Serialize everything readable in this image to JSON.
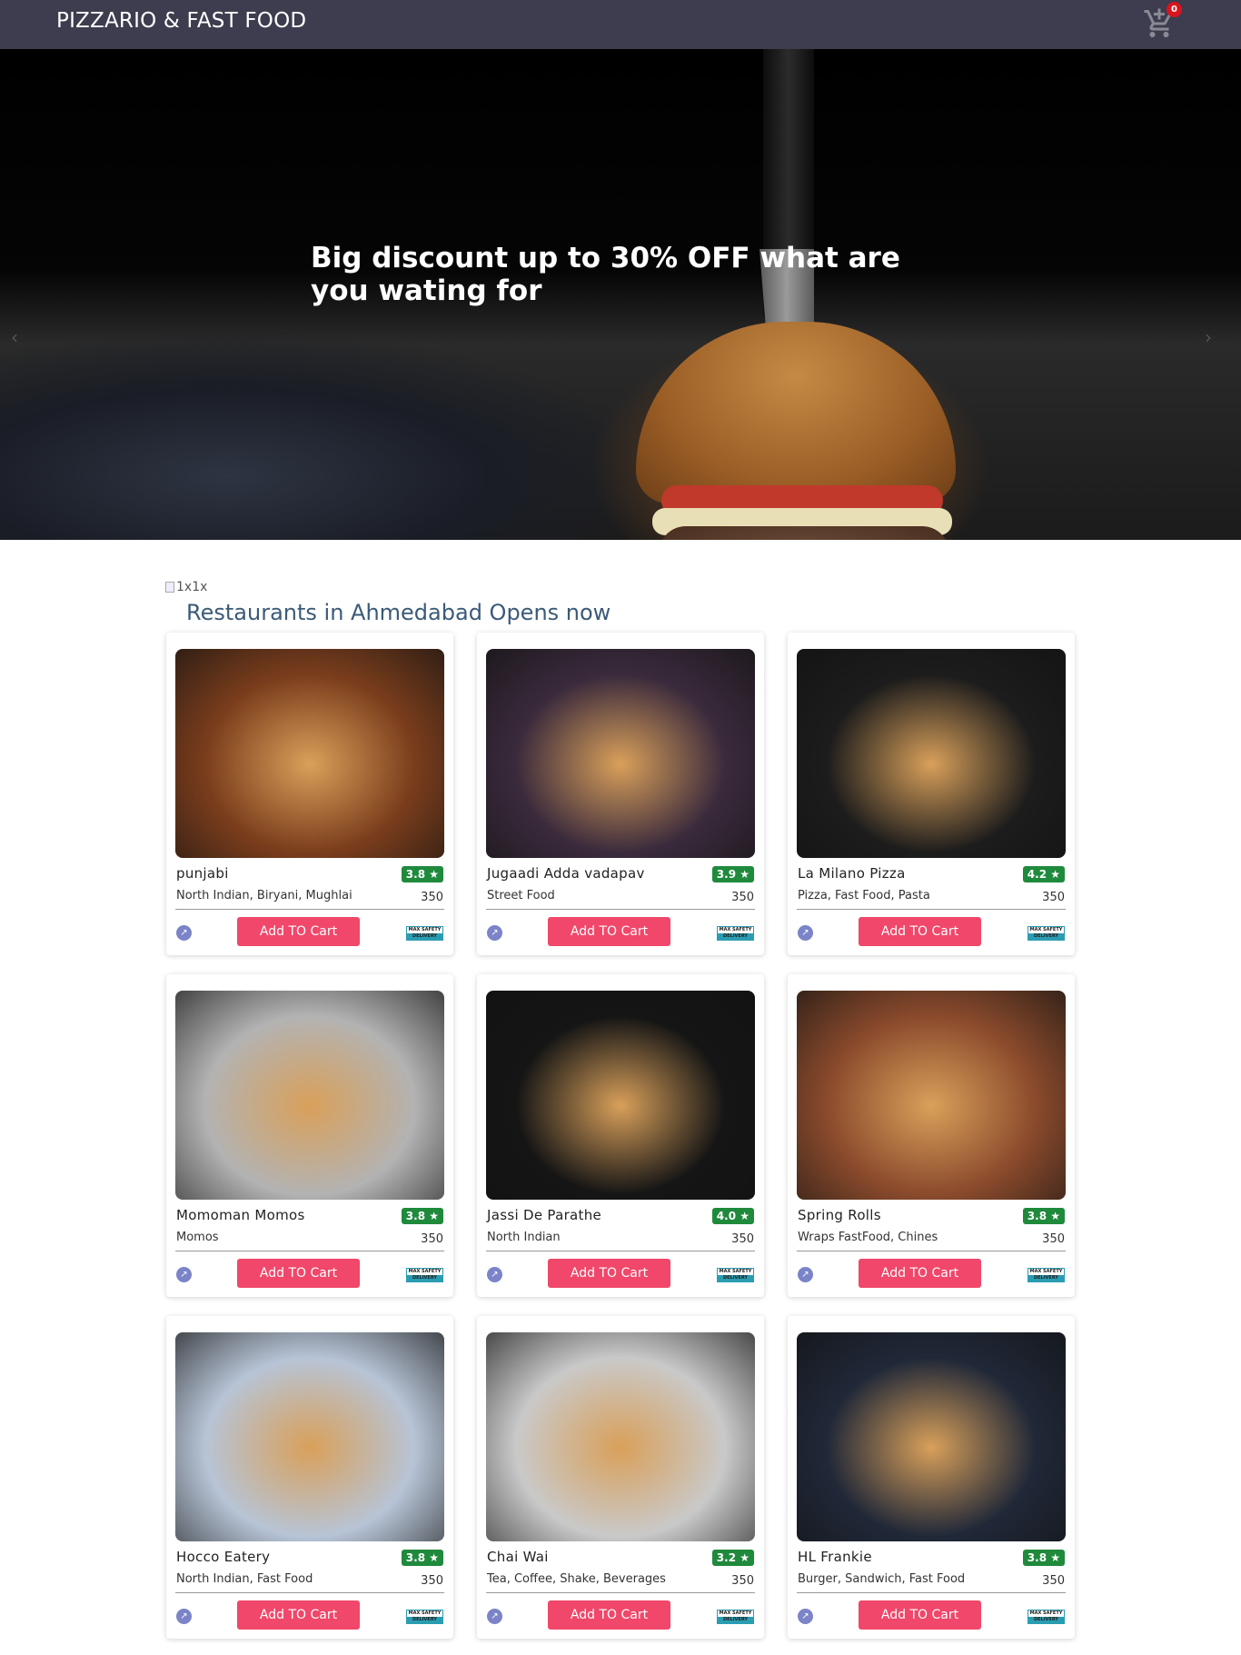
{
  "header": {
    "brand": "PIZZARIO & FAST FOOD",
    "cart_count": "0",
    "cart_icon": "cart-plus-icon"
  },
  "hero": {
    "headline": "Big discount up to 30% OFF what are you wating for",
    "slide_count": 4,
    "active_slide": 1,
    "prev_icon": "chevron-left-icon",
    "next_icon": "chevron-right-icon"
  },
  "section": {
    "image_alt": "1x1x",
    "title": "Restaurants in Ahmedabad Opens now"
  },
  "restaurants": [
    {
      "name": "punjabi",
      "rating": "3.8 ★",
      "cuisine": "North Indian, Biryani, Mughlai",
      "price": "350",
      "button": "Add TO Cart",
      "safety": "MAX SAFETY DELIVERY",
      "accent": "#7a3d1c"
    },
    {
      "name": "Jugaadi Adda vadapav",
      "rating": "3.9 ★",
      "cuisine": "Street Food",
      "price": "350",
      "button": "Add TO Cart",
      "safety": "MAX SAFETY DELIVERY",
      "accent": "#3a2a3c"
    },
    {
      "name": "La Milano Pizza",
      "rating": "4.2 ★",
      "cuisine": "Pizza, Fast Food, Pasta",
      "price": "350",
      "button": "Add TO Cart",
      "safety": "MAX SAFETY DELIVERY",
      "accent": "#1c1c1c"
    },
    {
      "name": "Momoman Momos",
      "rating": "3.8 ★",
      "cuisine": "Momos",
      "price": "350",
      "button": "Add TO Cart",
      "safety": "MAX SAFETY DELIVERY",
      "accent": "#b3b3b3"
    },
    {
      "name": "Jassi De Parathe",
      "rating": "4.0 ★",
      "cuisine": "North Indian",
      "price": "350",
      "button": "Add TO Cart",
      "safety": "MAX SAFETY DELIVERY",
      "accent": "#151515"
    },
    {
      "name": "Spring Rolls",
      "rating": "3.8 ★",
      "cuisine": "Wraps FastFood, Chines",
      "price": "350",
      "button": "Add TO Cart",
      "safety": "MAX SAFETY DELIVERY",
      "accent": "#8a4a2c"
    },
    {
      "name": "Hocco Eatery",
      "rating": "3.8 ★",
      "cuisine": "North Indian, Fast Food",
      "price": "350",
      "button": "Add TO Cart",
      "safety": "MAX SAFETY DELIVERY",
      "accent": "#b7c4d6"
    },
    {
      "name": "Chai Wai",
      "rating": "3.2 ★",
      "cuisine": "Tea, Coffee, Shake, Beverages",
      "price": "350",
      "button": "Add TO Cart",
      "safety": "MAX SAFETY DELIVERY",
      "accent": "#c9c9c9"
    },
    {
      "name": "HL Frankie",
      "rating": "3.8 ★",
      "cuisine": "Burger, Sandwich, Fast Food",
      "price": "350",
      "button": "Add TO Cart",
      "safety": "MAX SAFETY DELIVERY",
      "accent": "#202838"
    }
  ],
  "colors": {
    "navbar": "#3d3d4f",
    "rating_badge": "#1f8a3c",
    "add_button": "#f0476a",
    "active_dot": "#28a745",
    "section_title": "#3b5a78"
  }
}
